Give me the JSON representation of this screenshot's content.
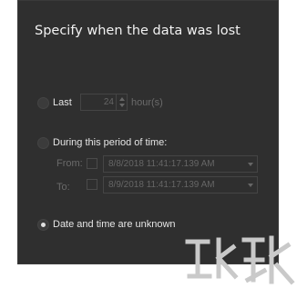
{
  "dialog": {
    "title": "Specify when the data was lost",
    "options": {
      "last": {
        "label": "Last",
        "value": "24",
        "unit": "hour(s)",
        "selected": false
      },
      "period": {
        "label": "During this period of time:",
        "selected": false,
        "from_label": "From:",
        "to_label": "To:",
        "from_value": "8/8/2018 11:41:17.139 AM",
        "to_value": "8/9/2018 11:41:17.139 AM"
      },
      "unknown": {
        "label": "Date and time are unknown",
        "selected": true
      }
    }
  }
}
